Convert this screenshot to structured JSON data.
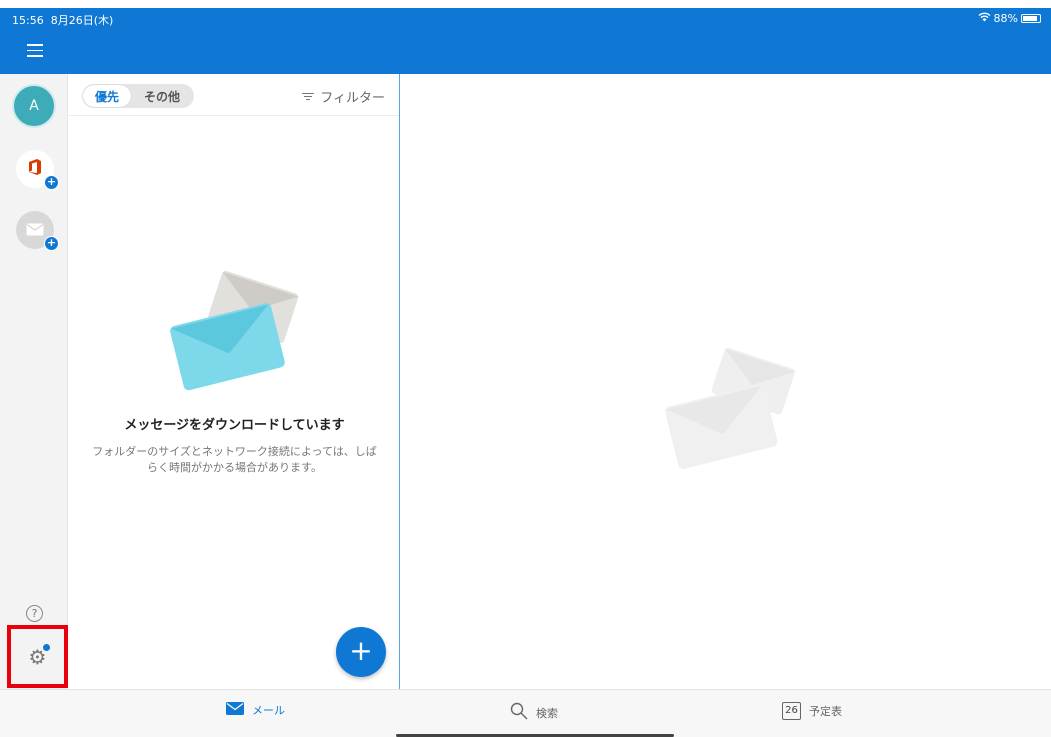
{
  "status_bar": {
    "time": "15:56",
    "date": "8月26日(木)",
    "battery": "88%"
  },
  "header": {
    "menu_icon": "hamburger-icon"
  },
  "sidebar": {
    "account_initial": "A",
    "accounts": [
      {
        "icon": "office-icon"
      },
      {
        "icon": "mail-account-icon"
      }
    ],
    "help_icon": "help-icon",
    "settings_icon": "gear-icon"
  },
  "inbox": {
    "tabs": [
      {
        "label": "優先",
        "selected": true
      },
      {
        "label": "その他",
        "selected": false
      }
    ],
    "filter_label": "フィルター",
    "empty_title": "メッセージをダウンロードしています",
    "empty_description": "フォルダーのサイズとネットワーク接続によっては、しばらく時間がかかる場合があります。"
  },
  "tabbar": {
    "mail_label": "メール",
    "search_label": "検索",
    "calendar_label": "予定表",
    "calendar_day": "26"
  },
  "colors": {
    "accent": "#0f78d4",
    "highlight_box": "#e8000b",
    "teal_avatar": "#3eabb8"
  }
}
